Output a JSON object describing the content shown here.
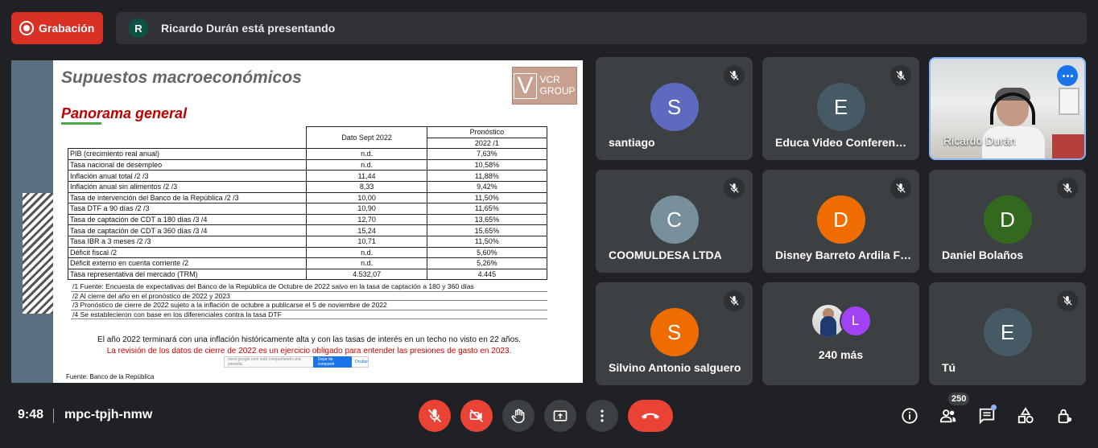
{
  "topbar": {
    "recording_label": "Grabación",
    "presenter_initial": "R",
    "presenting_text": "Ricardo Durán está presentando"
  },
  "slide": {
    "title": "Supuestos macroeconómicos",
    "subtitle": "Panorama general",
    "logo_letter": "V",
    "logo_line1": "VCR",
    "logo_line2": "GROUP",
    "col_dato": "Dato Sept 2022",
    "col_pronostico": "Pronóstico",
    "col_pronostico_sub": "2022 /1",
    "rows": [
      {
        "label": "PIB (crecimiento real anual)",
        "dato": "n.d.",
        "pron": "7,63%"
      },
      {
        "label": "Tasa nacional de desempleo",
        "dato": "n.d.",
        "pron": "10,58%"
      },
      {
        "label": "Inflación anual total /2 /3",
        "dato": "11,44",
        "pron": "11,88%"
      },
      {
        "label": "Inflación anual sin alimentos /2 /3",
        "dato": "8,33",
        "pron": "9,42%"
      },
      {
        "label": "Tasa de intervención del Banco de la República /2 /3",
        "dato": "10,00",
        "pron": "11,50%"
      },
      {
        "label": "Tasa DTF a 90 días /2 /3",
        "dato": "10,90",
        "pron": "11,65%"
      },
      {
        "label": "Tasa de captación de CDT a 180 días /3 /4",
        "dato": "12,70",
        "pron": "13,65%"
      },
      {
        "label": "Tasa de captación de CDT a 360 días /3 /4",
        "dato": "15,24",
        "pron": "15,65%"
      },
      {
        "label": "Tasa IBR a 3 meses /2 /3",
        "dato": "10,71",
        "pron": "11,50%"
      },
      {
        "label": "Déficit fiscal /2",
        "dato": "n.d.",
        "pron": "5,60%"
      },
      {
        "label": "Déficit externo en cuenta corriente /2",
        "dato": "n.d.",
        "pron": "5,26%"
      },
      {
        "label": "Tasa representativa del mercado (TRM)",
        "dato": "4.532,07",
        "pron": "4.445"
      }
    ],
    "notes": [
      "/1 Fuente: Encuesta de expectativas del Banco de la República de Octubre de 2022 salvo en la tasa de captación a 180 y 360 días",
      "/2 Al cierre del año en el pronóstico de 2022 y 2023",
      "/3 Pronóstico de cierre de 2022 sujeto a la inflación de octubre a publicarse el 5 de noviembre de 2022",
      "/4 Se establecieron con base en los diferenciales contra la tasa DTF"
    ],
    "conclusion": "El año 2022 terminará con una inflación históricamente alta y con las tasas de interés en un techo no visto en 22 años.",
    "conclusion_red": "La revisión de los datos de cierre de 2022 es un ejercicio obligado para entender las presiones de gasto en 2023.",
    "share_text": "meet.google.com está compartiendo una pantalla.",
    "share_stop": "Dejar de compartir",
    "share_hide": "Ocultar",
    "source": "Fuente: Banco de la República"
  },
  "participants": [
    {
      "initial": "S",
      "name": "santiago",
      "color": "#5c6bc0"
    },
    {
      "initial": "E",
      "name": "Educa Video Conferencias",
      "color": "#455a64"
    },
    {
      "initial": "",
      "name": "Ricardo Durán",
      "color": ""
    },
    {
      "initial": "C",
      "name": "COOMULDESA LTDA",
      "color": "#78909c"
    },
    {
      "initial": "D",
      "name": "Disney Barreto Ardila Fonseca",
      "color": "#ef6c00"
    },
    {
      "initial": "D",
      "name": "Daniel Bolaños",
      "color": "#33691e"
    },
    {
      "initial": "S",
      "name": "Silvino Antonio salguero",
      "color": "#ef6c00"
    },
    {
      "initial": "L",
      "name": "240 más",
      "color": "#a142f4"
    },
    {
      "initial": "E",
      "name": "Tú",
      "color": "#455a64"
    }
  ],
  "bottombar": {
    "time": "9:48",
    "meeting_code": "mpc-tpjh-nmw",
    "people_count": "250"
  }
}
